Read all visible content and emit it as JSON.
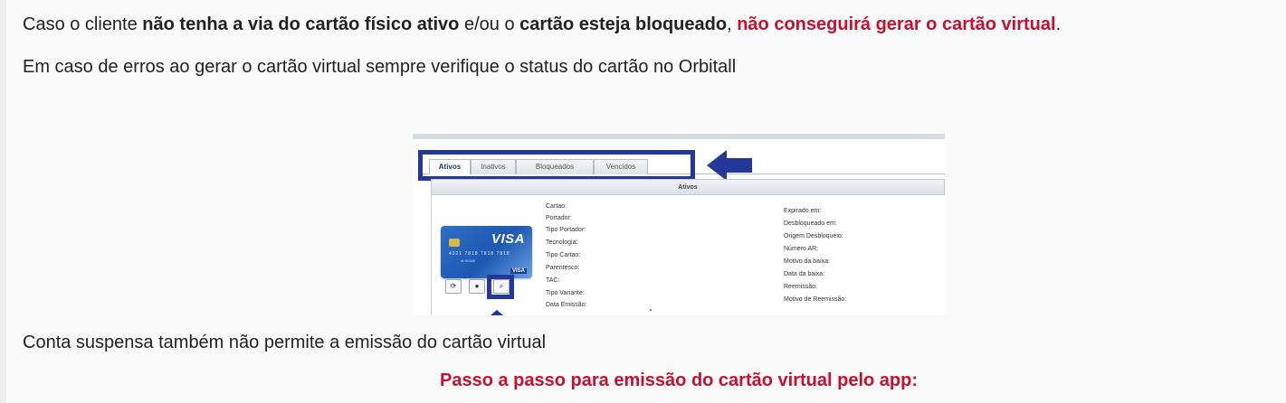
{
  "paragraph1": {
    "part1": "Caso o cliente ",
    "bold1": "não tenha a via do cartão físico ativo",
    "part2": " e/ou o ",
    "bold2": "cartão esteja bloqueado",
    "part3": ", ",
    "red": "não conseguirá gerar o cartão virtual",
    "part4": "."
  },
  "paragraph2": "Em caso de erros ao gerar o cartão virtual sempre verifique o status do cartão no Orbitall",
  "screenshot": {
    "tabs": [
      "Ativos",
      "Inativos",
      "Bloqueados",
      "Vencidos"
    ],
    "section_header": "Ativos",
    "card_brand": "VISA",
    "card_number": "4321 7818 7818 7818",
    "card_holder": "M NOME",
    "card_brand_small": "VISA",
    "buttons": [
      "⟳",
      "●",
      "⌕"
    ],
    "left_fields": [
      "Cartao:",
      "Portador:",
      "Tipo Portador:",
      "Tecnologia:",
      "Tipo Cartao:",
      "Parentesco:",
      "TAC:",
      "Tipo Variante:",
      "Data Emissão:"
    ],
    "right_fields": [
      "Expirado em:",
      "Desbloqueado em:",
      "Origem Desbloqueio:",
      "Número AR:",
      "Motivo da baixa:",
      "Data da baixa:",
      "Reemissão:",
      "Motivo de Reemissão:"
    ]
  },
  "paragraph3": "Conta suspensa também não permite a emissão do cartão virtual",
  "section_title": "Passo a passo para emissão do cartão virtual pelo app:",
  "colors": {
    "accent_red": "#c8102e",
    "highlight_blue": "#23389a"
  }
}
